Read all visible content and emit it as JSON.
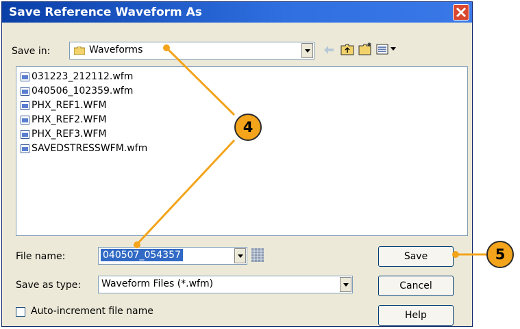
{
  "dialog": {
    "title": "Save Reference Waveform As",
    "save_in_label": "Save in:",
    "save_in_value": "Waveforms",
    "files": [
      "031223_212112.wfm",
      "040506_102359.wfm",
      "PHX_REF1.WFM",
      "PHX_REF2.WFM",
      "PHX_REF3.WFM",
      "SAVEDSTRESSWFM.wfm"
    ],
    "file_name_label": "File name:",
    "file_name_value": "040507_054357",
    "save_type_label": "Save as type:",
    "save_type_value": "Waveform Files (*.wfm)",
    "auto_increment_label": "Auto-increment file name",
    "buttons": {
      "save": "Save",
      "cancel": "Cancel",
      "help": "Help"
    }
  },
  "callouts": {
    "c4": "4",
    "c5": "5"
  },
  "colors": {
    "titlebar": "#0a3fa8",
    "callout": "#f3a41b",
    "selection": "#316ac5"
  }
}
